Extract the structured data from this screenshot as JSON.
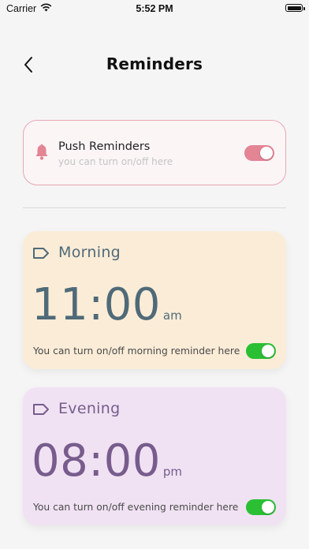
{
  "status_bar": {
    "carrier": "Carrier",
    "time": "5:52 PM"
  },
  "header": {
    "title": "Reminders"
  },
  "push": {
    "title": "Push Reminders",
    "subtitle": "you can turn on/off here",
    "enabled": true
  },
  "reminders": [
    {
      "name": "Morning",
      "time": "11:00",
      "period": "am",
      "hint": "You can turn on/off morning reminder here",
      "enabled": true
    },
    {
      "name": "Evening",
      "time": "08:00",
      "period": "pm",
      "hint": "You can turn on/off evening reminder here",
      "enabled": true
    }
  ],
  "colors": {
    "accent_pink": "#e38595",
    "toggle_green": "#2bbf34",
    "morning_bg": "#fbecd7",
    "morning_text": "#4f6a78",
    "evening_bg": "#f0e2f3",
    "evening_text": "#775c8d"
  }
}
